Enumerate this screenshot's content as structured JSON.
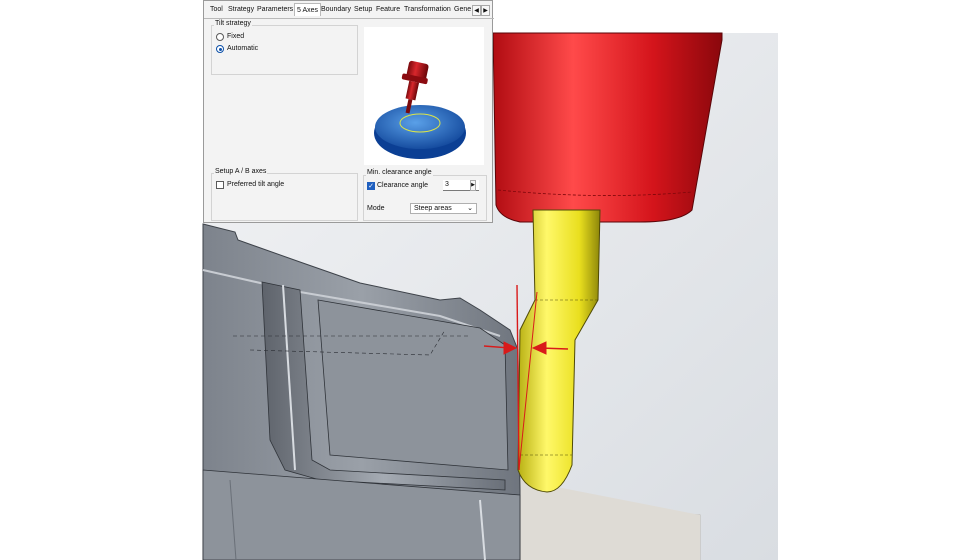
{
  "dialog": {
    "tabs": [
      {
        "label": "Tool"
      },
      {
        "label": "Strategy"
      },
      {
        "label": "Parameters"
      },
      {
        "label": "5 Axes"
      },
      {
        "label": "Boundary"
      },
      {
        "label": "Setup"
      },
      {
        "label": "Feature"
      },
      {
        "label": "Transformation"
      },
      {
        "label": "Gene"
      }
    ],
    "active_tab": "5 Axes",
    "tilt_strategy": {
      "title": "Tilt strategy",
      "options": [
        {
          "label": "Fixed",
          "selected": false
        },
        {
          "label": "Automatic",
          "selected": true
        }
      ]
    },
    "setup": {
      "title": "Setup  A / B axes",
      "preferred_tilt_label": "Preferred tilt angle",
      "preferred_tilt_checked": false
    },
    "min_clearance": {
      "title": "Min. clearance angle",
      "clearance_label": "Clearance angle",
      "clearance_checked": true,
      "clearance_value": "3",
      "mode_label": "Mode",
      "mode_value": "Steep areas"
    }
  },
  "colors": {
    "holder": "#d4141b",
    "tool": "#f2ea2a",
    "part": "#8a9099",
    "table": "#e6e4df",
    "arrow": "#d91a1a",
    "accent": "#0b4fa8"
  }
}
